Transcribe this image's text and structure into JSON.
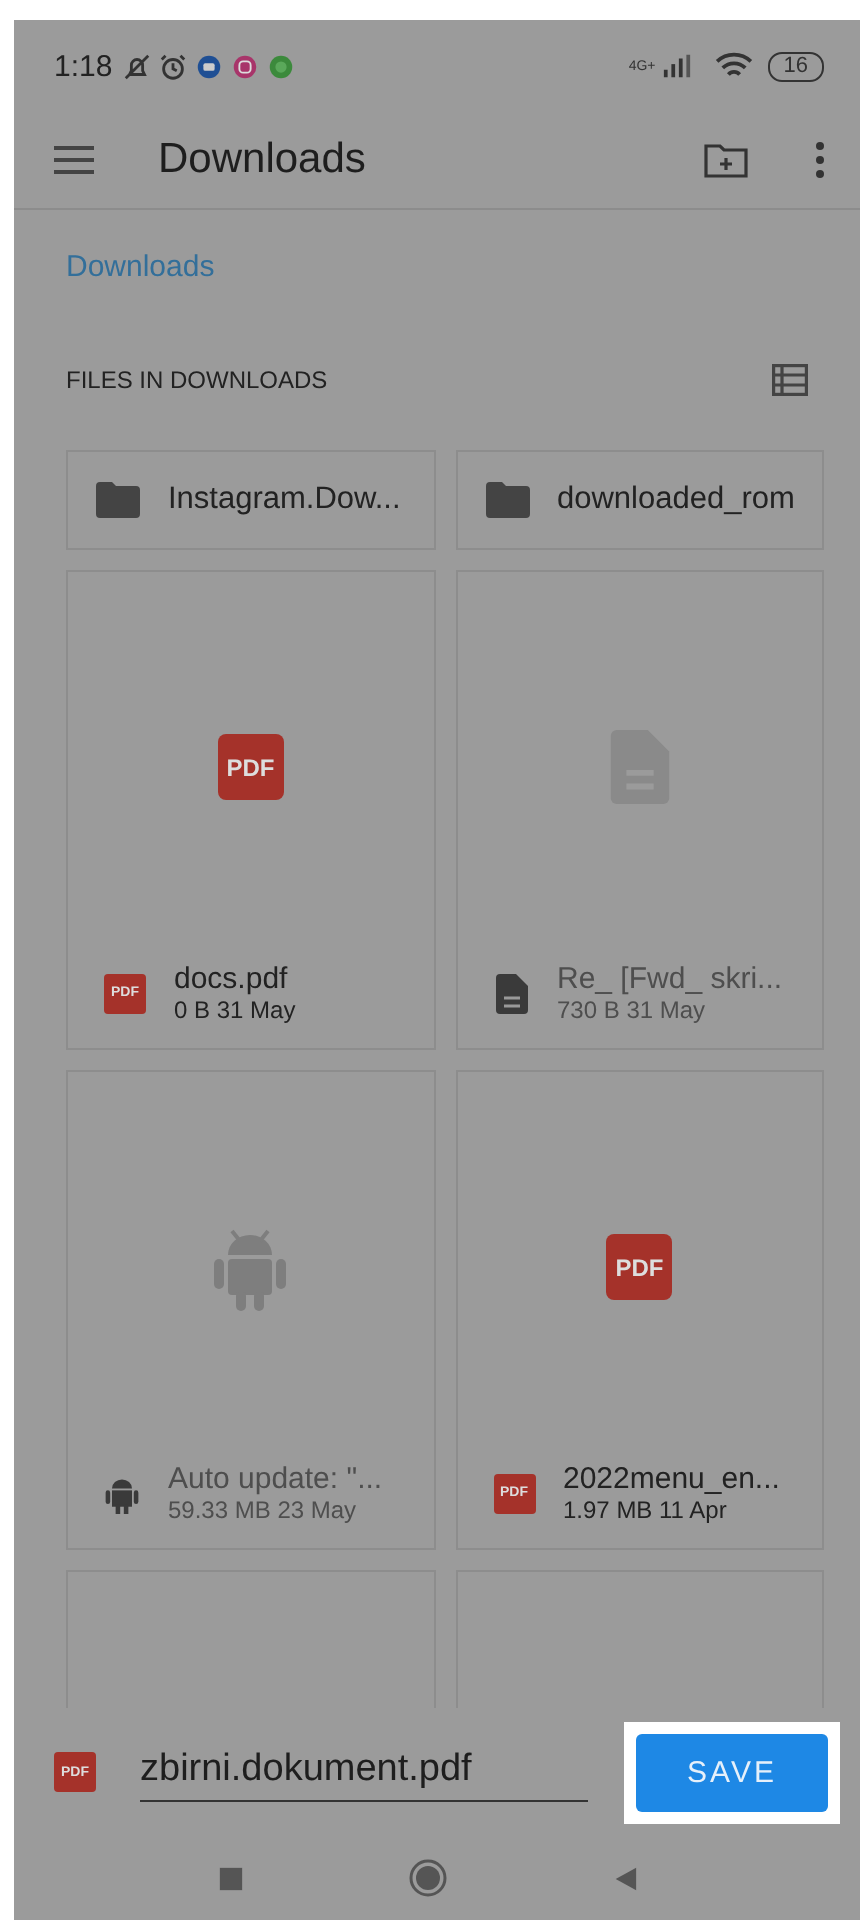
{
  "status_bar": {
    "time": "1:18",
    "network": "4G+",
    "battery": "16"
  },
  "toolbar": {
    "title": "Downloads"
  },
  "breadcrumb": "Downloads",
  "section": {
    "title": "FILES IN DOWNLOADS"
  },
  "folders": [
    {
      "name": "Instagram.Dow..."
    },
    {
      "name": "downloaded_rom"
    }
  ],
  "files": [
    {
      "kind": "pdf",
      "thumb_label": "PDF",
      "icon_label": "PDF",
      "name": "docs.pdf",
      "meta": "0 B 31 May",
      "disabled": false
    },
    {
      "kind": "doc",
      "name": "Re_ [Fwd_ skri...",
      "meta": "730 B 31 May",
      "disabled": true
    },
    {
      "kind": "android",
      "name": "Auto update: \"...",
      "meta": "59.33 MB 23 May",
      "disabled": true
    },
    {
      "kind": "pdf",
      "thumb_label": "PDF",
      "icon_label": "PDF",
      "name": "2022menu_en...",
      "meta": "1.97 MB 11 Apr",
      "disabled": false
    },
    {
      "kind": "blank"
    },
    {
      "kind": "blank"
    }
  ],
  "save_bar": {
    "icon_label": "PDF",
    "filename": "zbirni.dokument.pdf",
    "button": "SAVE"
  }
}
